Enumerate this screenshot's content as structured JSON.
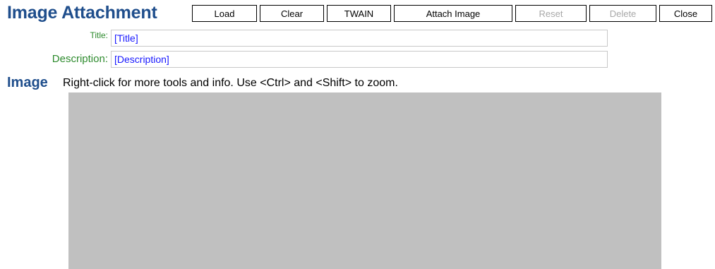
{
  "header": {
    "title": "Image Attachment"
  },
  "toolbar": {
    "load_label": "Load",
    "clear_label": "Clear",
    "twain_label": "TWAIN",
    "attach_label": "Attach Image",
    "reset_label": "Reset",
    "delete_label": "Delete",
    "close_label": "Close"
  },
  "form": {
    "title_label": "Title:",
    "title_value": "[Title]",
    "description_label": "Description:",
    "description_value": "[Description]"
  },
  "image_section": {
    "heading": "Image",
    "hint": "Right-click for more tools and info. Use <Ctrl> and <Shift> to zoom."
  },
  "colors": {
    "title": "#1f4e8c",
    "label": "#2e8b2e",
    "field_text": "#1a1aff",
    "canvas": "#c0c0c0",
    "disabled": "#a8a8a8"
  }
}
